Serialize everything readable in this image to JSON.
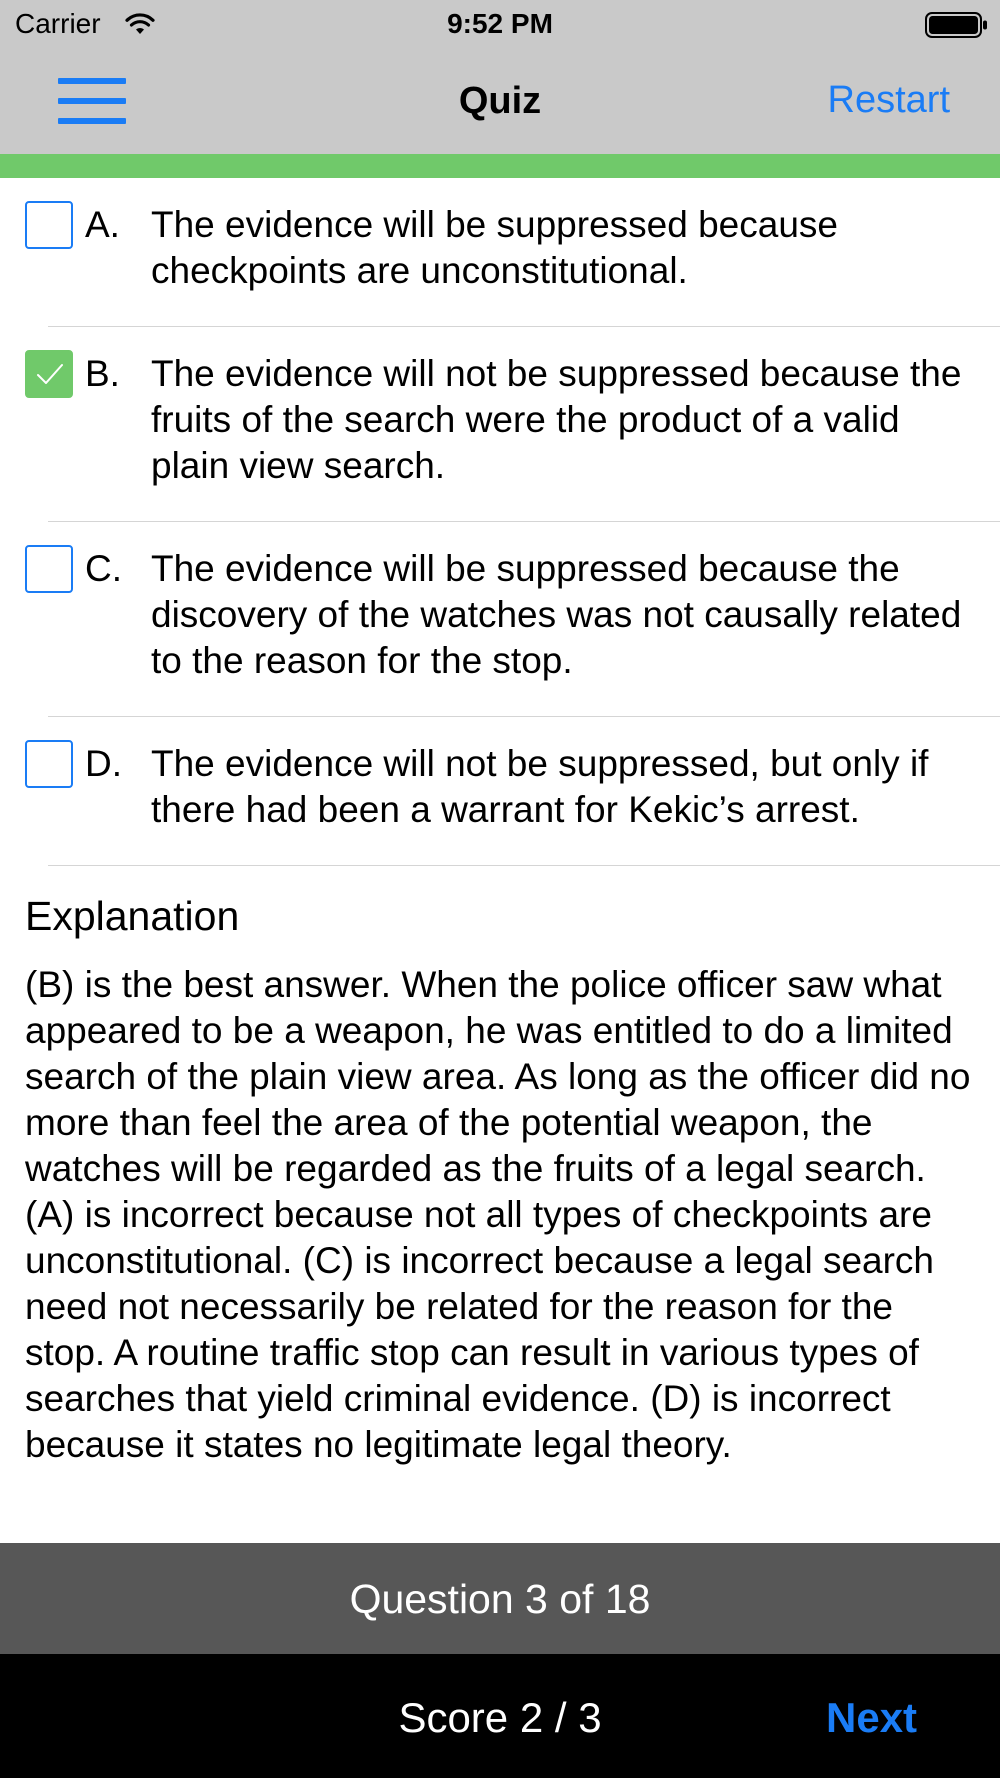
{
  "status_bar": {
    "carrier": "Carrier",
    "time": "9:52 PM",
    "wifi_icon": "wifi-icon",
    "battery_icon": "battery-full-icon"
  },
  "nav": {
    "menu_icon": "hamburger-menu-icon",
    "title": "Quiz",
    "restart_label": "Restart"
  },
  "progress": {
    "fraction": 1.0,
    "color": "#70c96a"
  },
  "options": [
    {
      "letter": "A.",
      "text": "The evidence will be suppressed because checkpoints are unconstitutional.",
      "checked": false
    },
    {
      "letter": "B.",
      "text": "The evidence will not be suppressed because the fruits of the search were the product of a valid plain view search.",
      "checked": true
    },
    {
      "letter": "C.",
      "text": "The evidence will be suppressed because the discovery of the watches was not causally related to the reason for the stop.",
      "checked": false
    },
    {
      "letter": "D.",
      "text": "The evidence will not be suppressed, but only if there had been a warrant for Kekic’s arrest.",
      "checked": false
    }
  ],
  "explanation": {
    "title": "Explanation",
    "text": "(B) is the best answer.  When the police officer saw what appeared to be a weapon, he was entitled to do a limited search of the plain view area.  As long as the officer did no more than feel the area of the potential weapon, the watches will be regarded as the fruits of a legal search.  (A) is incorrect because not all types of checkpoints are unconstitutional.  (C) is incorrect because a legal search need not necessarily be related for the reason for the stop.  A routine traffic stop can result in various types of searches that yield criminal evidence.  (D) is incorrect because it states no legitimate legal theory."
  },
  "question_bar": {
    "label": "Question 3 of 18"
  },
  "bottom_bar": {
    "score": "Score 2 / 3",
    "next_label": "Next"
  },
  "colors": {
    "accent": "#1a7cf5",
    "correct": "#70c96a",
    "bar_background": "#c9c9c9",
    "question_bar": "#575757",
    "bottom_bar": "#000000"
  }
}
